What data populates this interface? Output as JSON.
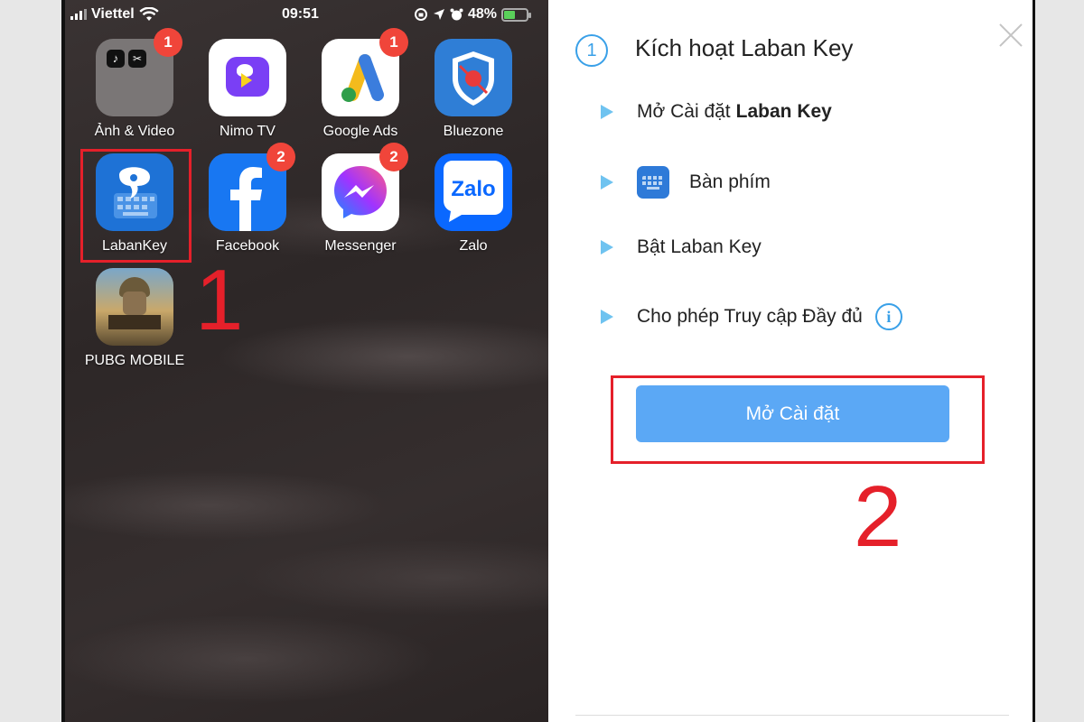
{
  "statusbar": {
    "carrier": "Viettel",
    "time": "09:51",
    "battery_percent": "48%",
    "battery_level": 0.48
  },
  "apps": [
    {
      "label": "Ảnh & Video",
      "badge": "1"
    },
    {
      "label": "Nimo TV",
      "badge": ""
    },
    {
      "label": "Google Ads",
      "badge": "1"
    },
    {
      "label": "Bluezone",
      "badge": ""
    },
    {
      "label": "LabanKey",
      "badge": ""
    },
    {
      "label": "Facebook",
      "badge": "2"
    },
    {
      "label": "Messenger",
      "badge": "2"
    },
    {
      "label": "Zalo",
      "badge": ""
    },
    {
      "label": "PUBG MOBILE",
      "badge": ""
    }
  ],
  "annotations": {
    "step1_number": "1",
    "step2_number": "2",
    "highlight_color": "#e5202a"
  },
  "panel": {
    "step_index": "1",
    "title": "Kích hoạt Laban Key",
    "steps": {
      "open_settings_prefix": "Mở Cài đặt",
      "open_settings_bold": "Laban Key",
      "keyboard": "Bàn phím",
      "enable": "Bật Laban Key",
      "full_access": "Cho phép Truy cập Đầy đủ"
    },
    "info_glyph": "i",
    "button_label": "Mở Cài đặt",
    "accent_color": "#39a0e8",
    "button_color": "#5ba8f5"
  },
  "zalo_wordmark": "Zalo"
}
